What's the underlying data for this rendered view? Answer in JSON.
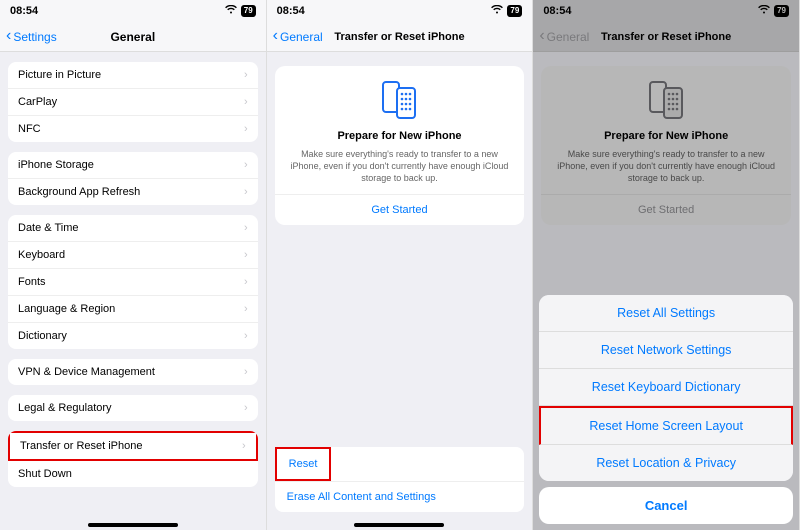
{
  "status": {
    "time": "08:54",
    "battery": "79"
  },
  "screen1": {
    "back": "Settings",
    "title": "General",
    "g1": [
      "Picture in Picture",
      "CarPlay",
      "NFC"
    ],
    "g2": [
      "iPhone Storage",
      "Background App Refresh"
    ],
    "g3": [
      "Date & Time",
      "Keyboard",
      "Fonts",
      "Language & Region",
      "Dictionary"
    ],
    "g4": [
      "VPN & Device Management"
    ],
    "g5": [
      "Legal & Regulatory"
    ],
    "g6": [
      "Transfer or Reset iPhone",
      "Shut Down"
    ]
  },
  "screen2": {
    "back": "General",
    "title": "Transfer or Reset iPhone",
    "card_title": "Prepare for New iPhone",
    "card_body": "Make sure everything's ready to transfer to a new iPhone, even if you don't currently have enough iCloud storage to back up.",
    "get_started": "Get Started",
    "reset": "Reset",
    "erase": "Erase All Content and Settings"
  },
  "screen3": {
    "back": "General",
    "title": "Transfer or Reset iPhone",
    "card_title": "Prepare for New iPhone",
    "card_body": "Make sure everything's ready to transfer to a new iPhone, even if you don't currently have enough iCloud storage to back up.",
    "get_started": "Get Started",
    "sheet": {
      "items": [
        "Reset All Settings",
        "Reset Network Settings",
        "Reset Keyboard Dictionary",
        "Reset Home Screen Layout",
        "Reset Location & Privacy"
      ],
      "cancel": "Cancel"
    }
  }
}
